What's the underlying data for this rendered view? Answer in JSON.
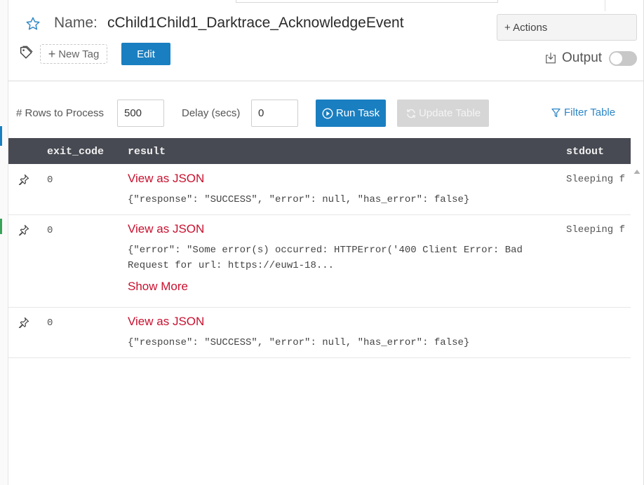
{
  "header": {
    "name_label": "Name:",
    "name_value": "cChild1Child1_Darktrace_AcknowledgeEvent",
    "new_tag_label": "New Tag",
    "edit_label": "Edit",
    "actions_label": "+ Actions",
    "output_label": "Output",
    "output_enabled": false,
    "icons": [
      "star-icon",
      "tag-icon",
      "plus-icon",
      "download-icon"
    ]
  },
  "controls": {
    "rows_label": "# Rows to Process",
    "rows_value": "500",
    "delay_label": "Delay (secs)",
    "delay_value": "0",
    "run_label": "Run Task",
    "update_label": "Update Table",
    "filter_label": "Filter Table"
  },
  "table": {
    "columns": [
      "exit_code",
      "result",
      "stdout"
    ],
    "rows": [
      {
        "exit_code": "0",
        "link": "View as JSON",
        "result": "{\"response\": \"SUCCESS\", \"error\": null, \"has_error\": false}",
        "stdout": "Sleeping f"
      },
      {
        "exit_code": "0",
        "link": "View as JSON",
        "result": "{\"error\": \"Some error(s) occurred: HTTPError('400 Client Error: Bad Request for url: https://euw1-18...",
        "show_more": "Show More",
        "stdout": "Sleeping f"
      },
      {
        "exit_code": "0",
        "link": "View as JSON",
        "result": "{\"response\": \"SUCCESS\", \"error\": null, \"has_error\": false}",
        "stdout": ""
      }
    ]
  },
  "colors": {
    "primary": "#1a7fc1",
    "link_red": "#c8102e",
    "header_bg": "#474a52",
    "disabled": "#d6d6d6",
    "filter_blue": "#2d86c6"
  }
}
